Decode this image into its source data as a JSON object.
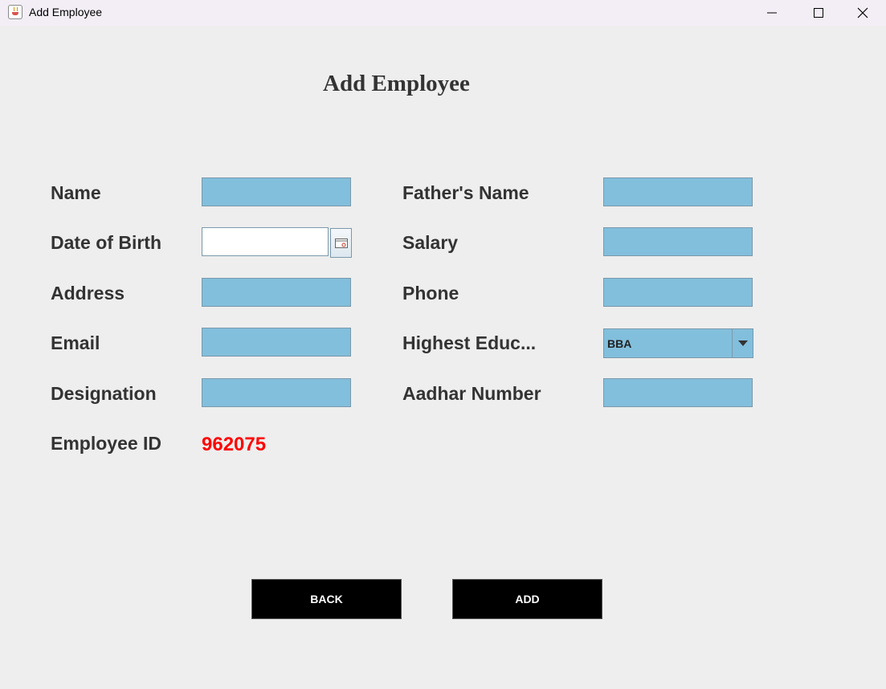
{
  "window": {
    "title": "Add Employee",
    "controls": [
      "minimize-icon",
      "maximize-icon",
      "close-icon"
    ]
  },
  "form": {
    "heading": "Add Employee",
    "labels": {
      "name": "Name",
      "fathers_name": "Father's Name",
      "dob": "Date of Birth",
      "salary": "Salary",
      "address": "Address",
      "phone": "Phone",
      "email": "Email",
      "education": "Highest Educ...",
      "designation": "Designation",
      "aadhar": "Aadhar Number",
      "employee_id": "Employee ID"
    },
    "values": {
      "name": "",
      "fathers_name": "",
      "dob": "",
      "salary": "",
      "address": "",
      "phone": "",
      "email": "",
      "designation": "",
      "aadhar": "",
      "education_selected": "BBA",
      "employee_id": "962075"
    },
    "buttons": {
      "back": "BACK",
      "add": "ADD"
    }
  },
  "colors": {
    "field_bg": "#82bfdc",
    "employee_id": "#ff0000",
    "button_bg": "#000000",
    "window_bg": "#eeeeee"
  }
}
